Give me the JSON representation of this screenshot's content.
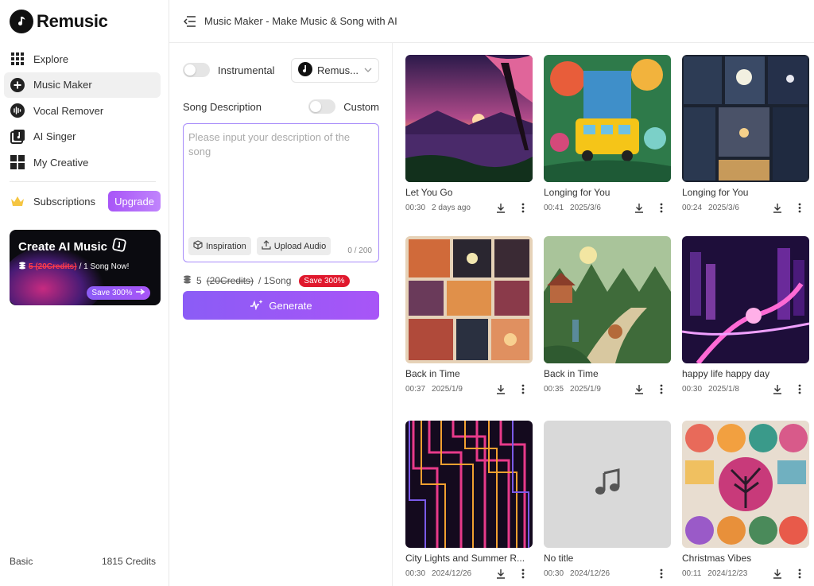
{
  "app": {
    "name": "Remusic"
  },
  "sidebar": {
    "items": [
      {
        "label": "Explore",
        "icon": "grid-icon"
      },
      {
        "label": "Music Maker",
        "icon": "plus-circle-icon",
        "active": true
      },
      {
        "label": "Vocal Remover",
        "icon": "waveform-icon"
      },
      {
        "label": "AI Singer",
        "icon": "music-note-square-icon"
      },
      {
        "label": "My Creative",
        "icon": "tiles-icon"
      }
    ],
    "subscriptions": {
      "label": "Subscriptions",
      "upgrade_label": "Upgrade"
    },
    "promo": {
      "title": "Create AI Music",
      "credits_text": "5 (20Credits)",
      "per_song": "/ 1 Song Now!",
      "save_label": "Save 300%"
    },
    "footer": {
      "plan": "Basic",
      "credits": "1815 Credits"
    }
  },
  "header": {
    "title": "Music Maker - Make Music & Song with AI"
  },
  "form": {
    "instrumental_label": "Instrumental",
    "model_label": "Remus...",
    "song_description_label": "Song Description",
    "custom_label": "Custom",
    "description_placeholder": "Please input your description of the song",
    "description_value": "",
    "inspiration_label": "Inspiration",
    "upload_audio_label": "Upload Audio",
    "counter": "0 / 200",
    "credits_count": "5",
    "credits_original": "(20Credits)",
    "credits_unit": "/ 1Song",
    "save_badge": "Save 300%",
    "generate_label": "Generate"
  },
  "songs": [
    {
      "title": "Let You Go",
      "duration": "00:30",
      "date": "2 days ago"
    },
    {
      "title": "Longing for You",
      "duration": "00:41",
      "date": "2025/3/6"
    },
    {
      "title": "Longing for You",
      "duration": "00:24",
      "date": "2025/3/6"
    },
    {
      "title": "Back in Time",
      "duration": "00:37",
      "date": "2025/1/9"
    },
    {
      "title": "Back in Time",
      "duration": "00:35",
      "date": "2025/1/9"
    },
    {
      "title": "happy life happy day",
      "duration": "00:30",
      "date": "2025/1/8"
    },
    {
      "title": "City Lights and Summer R...",
      "duration": "00:30",
      "date": "2024/12/26"
    },
    {
      "title": "No title",
      "duration": "00:30",
      "date": "2024/12/26"
    },
    {
      "title": "Christmas Vibes",
      "duration": "00:11",
      "date": "2024/12/23"
    }
  ],
  "colors": {
    "accent": "#a855f7",
    "badge_red": "#e0182d"
  }
}
